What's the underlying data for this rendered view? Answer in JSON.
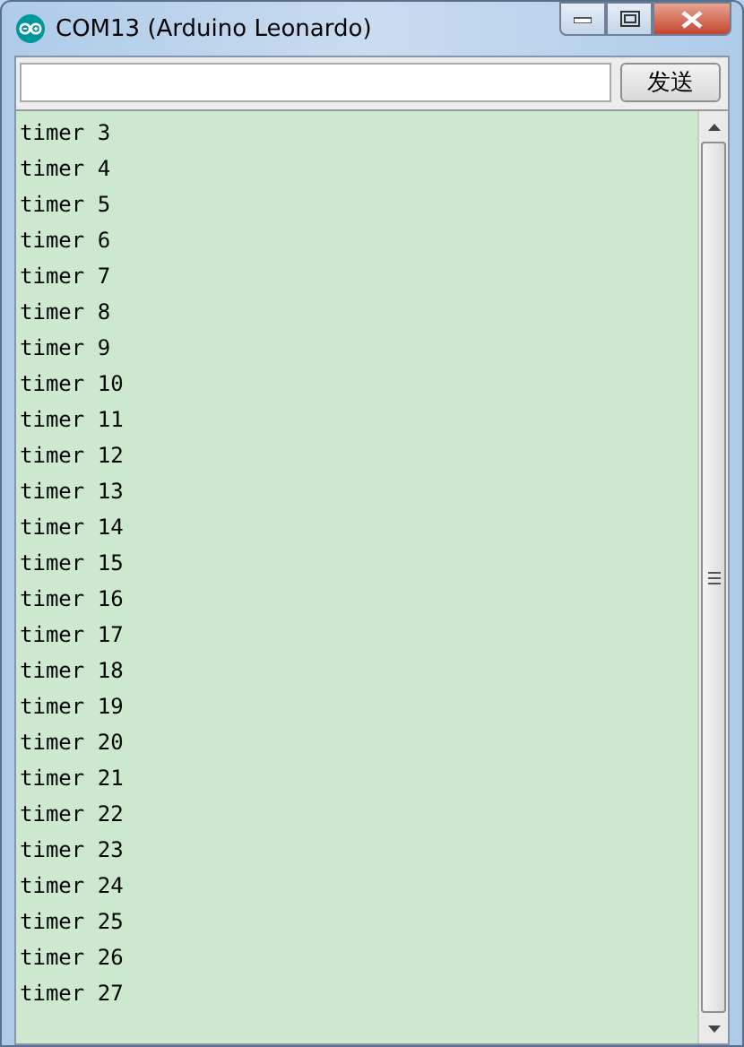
{
  "window": {
    "title": "COM13 (Arduino Leonardo)"
  },
  "send_button": {
    "label": "发送"
  },
  "output": {
    "lines": [
      "timer 3",
      "timer 4",
      "timer 5",
      "timer 6",
      "timer 7",
      "timer 8",
      "timer 9",
      "timer 10",
      "timer 11",
      "timer 12",
      "timer 13",
      "timer 14",
      "timer 15",
      "timer 16",
      "timer 17",
      "timer 18",
      "timer 19",
      "timer 20",
      "timer 21",
      "timer 22",
      "timer 23",
      "timer 24",
      "timer 25",
      "timer 26",
      "timer 27"
    ]
  }
}
